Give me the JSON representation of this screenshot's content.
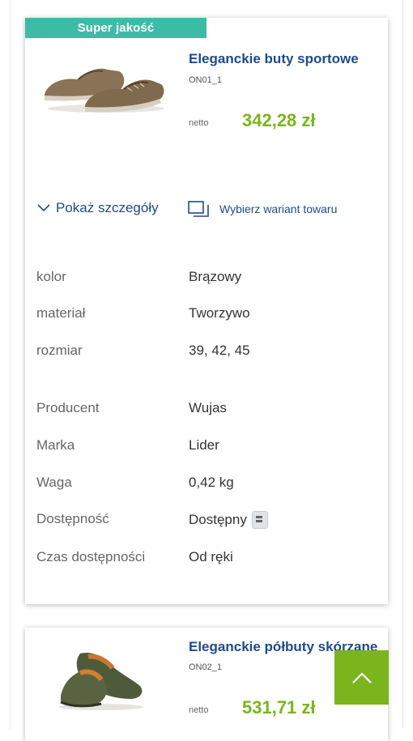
{
  "colors": {
    "badge": "#3ebba6",
    "price": "#7ab51d",
    "link": "#1e4b8a",
    "scroll_top": "#7ab51d"
  },
  "product1": {
    "badge": "Super jakość",
    "title": "Eleganckie buty sportowe",
    "code": "ON01_1",
    "netto_label": "netto",
    "price": "342,28 zł",
    "show_details_label": "Pokaż szczegóły",
    "choose_variant_label": "Wybierz wariant towaru",
    "attributes": [
      {
        "key": "kolor",
        "value": "Brązowy"
      },
      {
        "key": "materiał",
        "value": "Tworzywo"
      },
      {
        "key": "rozmiar",
        "value": "39, 42, 45"
      }
    ],
    "info": [
      {
        "key": "Producent",
        "value": "Wujas"
      },
      {
        "key": "Marka",
        "value": "Lider"
      },
      {
        "key": "Waga",
        "value": "0,42 kg"
      },
      {
        "key": "Dostępność",
        "value": "Dostępny"
      },
      {
        "key": "Czas dostępności",
        "value": "Od ręki"
      }
    ]
  },
  "product2": {
    "title": "Eleganckie półbuty skórzane",
    "code": "ON02_1",
    "netto_label": "netto",
    "price": "531,71 zł"
  },
  "icons": {
    "chevron": "chevron-down-icon",
    "variant": "variant-icon",
    "availability": "availability-icon",
    "scroll": "chevron-up-icon"
  }
}
